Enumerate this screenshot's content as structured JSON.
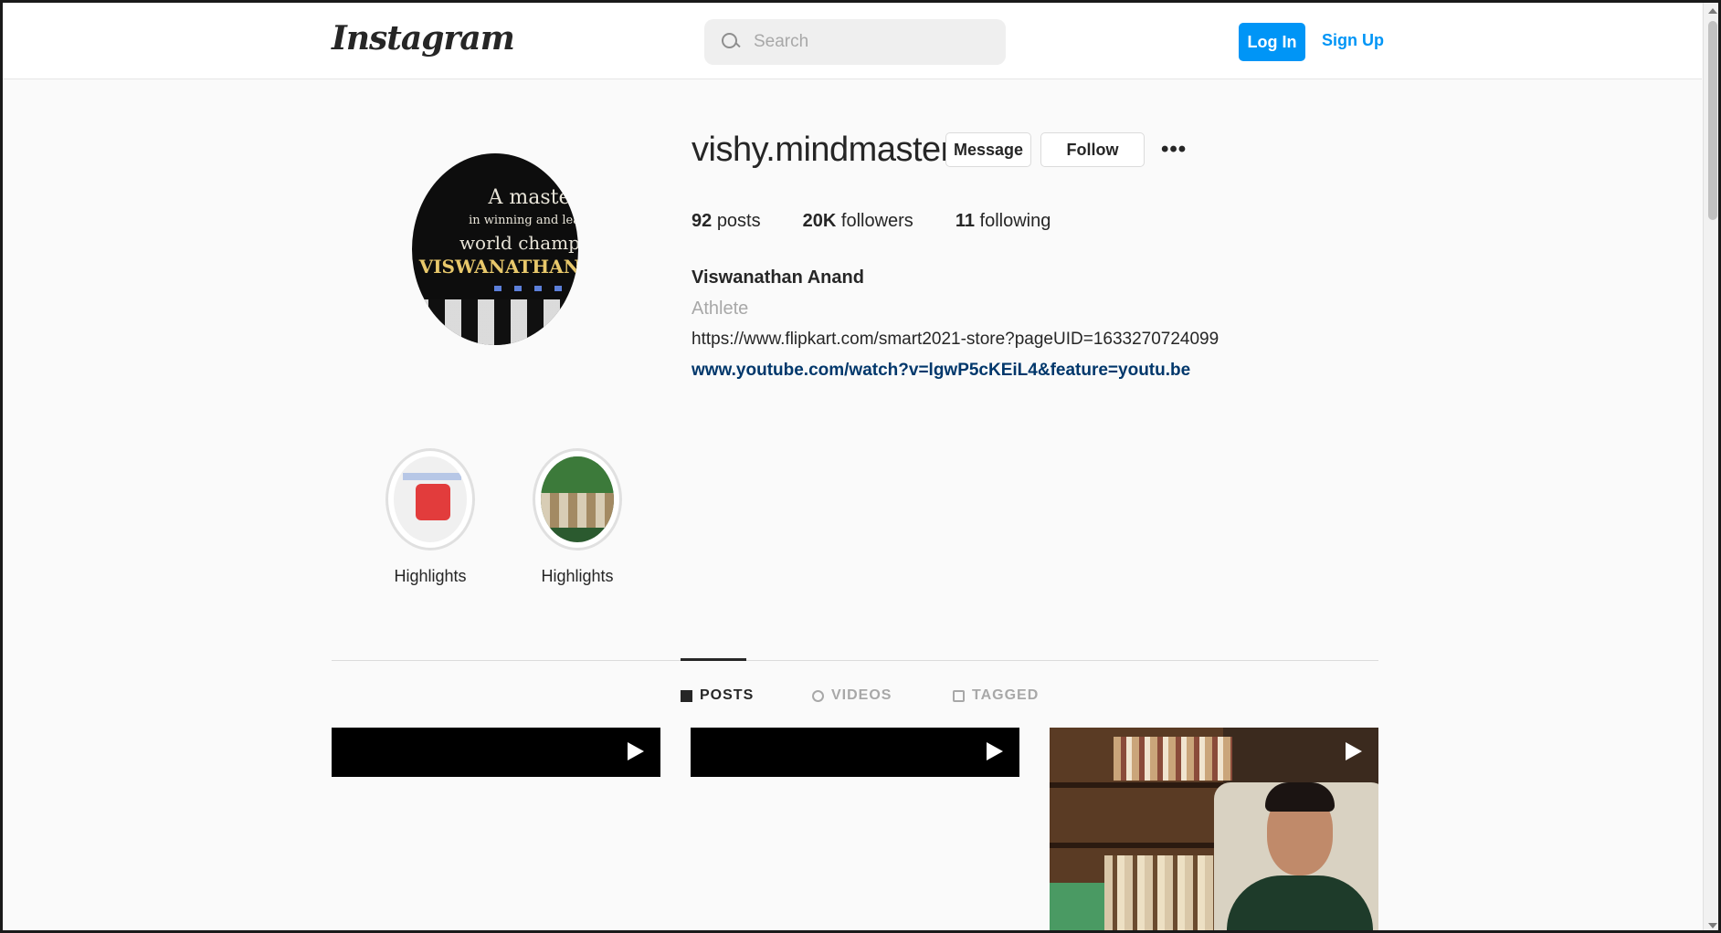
{
  "header": {
    "logo": "Instagram",
    "search_placeholder": "Search",
    "login_label": "Log In",
    "signup_label": "Sign Up"
  },
  "profile": {
    "avatar_text": [
      "A master",
      "in winning and lea",
      "world champ",
      "VISWANATHAN"
    ],
    "username": "vishy.mindmaster",
    "message_label": "Message",
    "follow_label": "Follow",
    "more_label": "•••",
    "stats": {
      "posts_count": "92",
      "posts_label": "posts",
      "followers_count": "20K",
      "followers_label": "followers",
      "following_count": "11",
      "following_label": "following"
    },
    "full_name": "Viswanathan Anand",
    "category": "Athlete",
    "bio_url": "https://www.flipkart.com/smart2021-store?pageUID=1633270724099",
    "external_link": "www.youtube.com/watch?v=lgwP5cKEiL4&feature=youtu.be"
  },
  "highlights": [
    {
      "label": "Highlights"
    },
    {
      "label": "Highlights"
    }
  ],
  "tabs": [
    {
      "label": "POSTS",
      "active": true
    },
    {
      "label": "VIDEOS",
      "active": false
    },
    {
      "label": "TAGGED",
      "active": false
    }
  ],
  "colors": {
    "accent": "#0095f6",
    "link": "#00376b",
    "text": "#262626",
    "muted": "#a8a8a8",
    "background": "#fafafa"
  }
}
